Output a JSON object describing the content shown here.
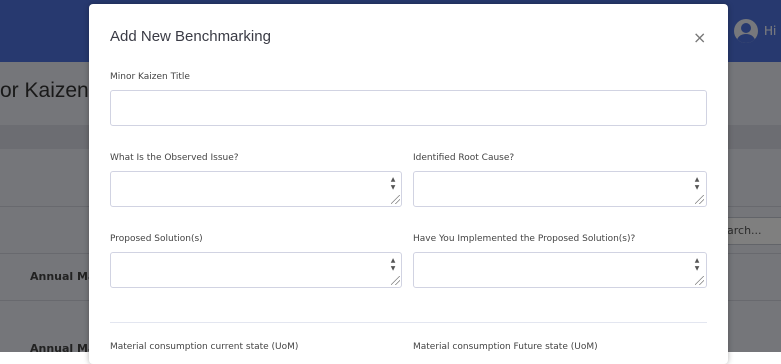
{
  "background": {
    "page_title": "or Kaizen",
    "user_label": "Hi",
    "search_placeholder": "arch...",
    "table_cells": [
      "Annual Mat",
      "Annual Mat"
    ]
  },
  "modal": {
    "title": "Add New Benchmarking",
    "close_label": "×",
    "fields": {
      "title_label": "Minor Kaizen Title",
      "issue_label": "What Is the Observed Issue?",
      "root_cause_label": "Identified Root Cause?",
      "solution_label": "Proposed Solution(s)",
      "implemented_label": "Have You Implemented the Proposed Solution(s)?",
      "material_current_label": "Material consumption current state (UoM)",
      "material_future_label": "Material consumption Future state (UoM)"
    }
  },
  "colors": {
    "header_blue": "#4e73df",
    "overlay": "rgba(0,0,0,0.5)"
  }
}
